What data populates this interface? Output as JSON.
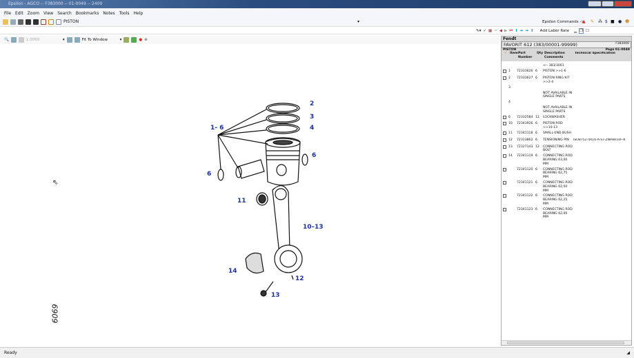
{
  "window": {
    "title": "Epsilon - AGCO -- F383000 -- 01-0049 -- 2409"
  },
  "menu": [
    "File",
    "Edit",
    "Zoom",
    "View",
    "Search",
    "Bookmarks",
    "Notes",
    "Tools",
    "Help"
  ],
  "toolbar1": {
    "doc_label": "PISTON",
    "commands_label": "Epsilon Commands ->"
  },
  "toolbar2": {
    "zoom_value": "1.0069",
    "fit_label": "Fit To Window"
  },
  "row3": {
    "add_labor_rate": "Add Labor Rate"
  },
  "panel": {
    "brand": "Fendt",
    "model": "FAVORIT 612 (383/00001-99999)",
    "code": "F383000",
    "section": "PISTON",
    "page": "Page 01-0049",
    "headers": {
      "item": "Item",
      "part": "Part Number",
      "qty": "Qty",
      "desc": "Description Comments",
      "spec": "Technical Specification"
    },
    "range_note": "<-- 383/3001",
    "rows": [
      {
        "cb": true,
        "item": "1",
        "part": "72333626",
        "qty": "6",
        "desc": "PISTON >>1-6",
        "spec": ""
      },
      {
        "cb": true,
        "item": "2",
        "part": "72333627",
        "qty": "6",
        "desc": "PISTON RING KIT >>2-4",
        "spec": ""
      },
      {
        "cb": false,
        "item": "3",
        "part": "",
        "qty": "",
        "desc": "",
        "spec": ""
      },
      {
        "cb": false,
        "item": "",
        "part": "",
        "qty": "",
        "desc": "NOT AVAILABLE IN SINGLE PARTS",
        "spec": ""
      },
      {
        "cb": false,
        "item": "4",
        "part": "",
        "qty": "",
        "desc": "",
        "spec": ""
      },
      {
        "cb": false,
        "item": "",
        "part": "",
        "qty": "",
        "desc": "NOT AVAILABLE IN SINGLE PARTS",
        "spec": ""
      },
      {
        "cb": true,
        "item": "6",
        "part": "72332584",
        "qty": "12",
        "desc": "LOCKWASHER",
        "spec": ""
      },
      {
        "cb": true,
        "item": "10",
        "part": "72343926",
        "qty": "6",
        "desc": "PISTON ROD >>10-13",
        "spec": ""
      },
      {
        "cb": true,
        "item": "11",
        "part": "72341118",
        "qty": "6",
        "desc": "SMALL-END BUSH",
        "spec": ""
      },
      {
        "cb": true,
        "item": "12",
        "part": "72313862",
        "qty": "6",
        "desc": "TENSIONING PIN",
        "spec": "ISO8752-4X16-A-ST-ZNPHR10F-K"
      },
      {
        "cb": true,
        "item": "13",
        "part": "72327143",
        "qty": "12",
        "desc": "CONNECTING ROD BOLT",
        "spec": ""
      },
      {
        "cb": true,
        "item": "14",
        "part": "72341119",
        "qty": "6",
        "desc": "CONNECTING ROD BEARING 63,00 MM",
        "spec": ""
      },
      {
        "cb": true,
        "item": "",
        "part": "72341120",
        "qty": "6",
        "desc": "CONNECTING ROD BEARING 62,75 MM",
        "spec": ""
      },
      {
        "cb": true,
        "item": "",
        "part": "72341121",
        "qty": "6",
        "desc": "CONNECTING ROD BEARING 62,50 MM",
        "spec": ""
      },
      {
        "cb": true,
        "item": "",
        "part": "72341122",
        "qty": "6",
        "desc": "CONNECTING ROD BEARING 62,25 MM",
        "spec": ""
      },
      {
        "cb": true,
        "item": "",
        "part": "72341123",
        "qty": "6",
        "desc": "CONNECTING ROD BEARING 62,00 MM",
        "spec": ""
      }
    ]
  },
  "drawing": {
    "labels": {
      "l2": "2",
      "l3": "3",
      "l4": "4",
      "l16": "1- 6",
      "l6a": "6",
      "l6b": "6",
      "l11": "11",
      "l1013": "10–13",
      "l14": "14",
      "l12": "12",
      "l13": "13"
    },
    "ref": "6069"
  },
  "status": {
    "text": "Ready"
  }
}
